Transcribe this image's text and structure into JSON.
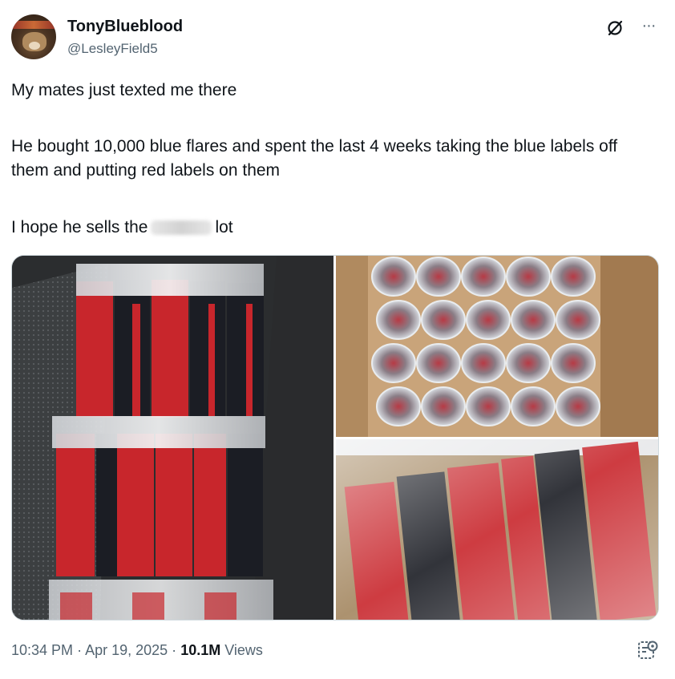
{
  "author": {
    "display_name": "TonyBlueblood",
    "handle": "@LesleyField5"
  },
  "icons": {
    "grok": "grok-icon",
    "more": "more-icon",
    "analytics": "analytics-icon"
  },
  "more_glyph": "···",
  "post": {
    "line1": "My mates just texted me there",
    "line2": "He bought 10,000 blue flares and spent the last 4 weeks taking the blue labels off them and putting red labels on them",
    "line3_start": "I hope he sells the",
    "line3_end": "lot"
  },
  "footer": {
    "time": "10:34 PM",
    "date": "Apr 19, 2025",
    "views_count": "10.1M",
    "views_label": "Views"
  },
  "colors": {
    "text": "#0f1419",
    "secondary": "#536471",
    "border": "#cfd9de",
    "flare_red": "#c8262c",
    "flare_dark": "#1b1d24"
  }
}
